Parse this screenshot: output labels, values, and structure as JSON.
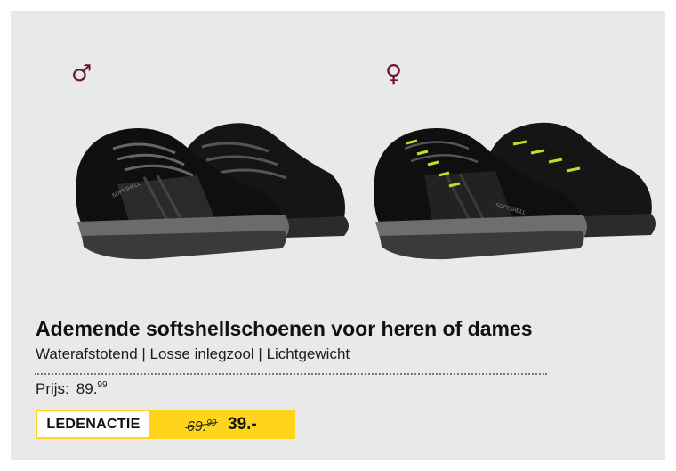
{
  "gender_symbols": {
    "male": "♂",
    "female": "♀"
  },
  "product": {
    "title": "Ademende softshellschoenen voor heren of dames",
    "subtitle": "Waterafstotend | Losse inlegzool | Lichtgewicht"
  },
  "price": {
    "label": "Prijs:",
    "main": "89.",
    "cents": "99"
  },
  "member": {
    "label": "LEDENACTIE",
    "old_main": "69.",
    "old_cents": "99",
    "new_price": "39.-"
  },
  "colors": {
    "background": "#e9e9e9",
    "gender_icon": "#6a1430",
    "member_yellow": "#ffd51c",
    "lace_accent": "#c8dc26"
  },
  "images": [
    {
      "icon": "men-hiking-shoes-image"
    },
    {
      "icon": "women-hiking-shoes-image"
    }
  ]
}
